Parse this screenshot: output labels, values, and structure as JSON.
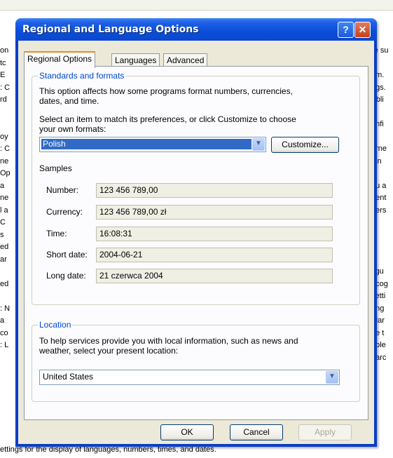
{
  "background": {
    "left_snippets": [
      "on",
      "tc",
      "E",
      ": C",
      "rd",
      "",
      "",
      "oy",
      ": C",
      "ne",
      "Op",
      "a",
      "ne",
      "l a",
      "C",
      "s",
      "ed",
      "ar",
      "",
      "ed",
      "",
      ": N",
      "a",
      "co",
      ": L"
    ],
    "right_snippets": [
      "re su",
      "",
      "em.",
      "ngs.",
      "r bli",
      "",
      "onfi",
      "",
      "erne",
      "ttin",
      "",
      "ou a",
      "nent",
      "bers",
      "",
      "",
      "",
      "",
      "figu",
      "ecog",
      "setti",
      "ang",
      "Mar",
      "he t",
      "ople",
      "narc"
    ],
    "status_line": "ettings for the display of languages, numbers, times, and dates."
  },
  "dialog": {
    "title": "Regional and Language Options",
    "help_label": "?",
    "close_label": "✕",
    "tabs": [
      {
        "label": "Regional Options"
      },
      {
        "label": "Languages"
      },
      {
        "label": "Advanced"
      }
    ],
    "standards": {
      "legend": "Standards and formats",
      "desc1": "This option affects how some programs format numbers, currencies,",
      "desc2": "dates, and time.",
      "instr1": "Select an item to match its preferences, or click Customize to choose",
      "instr2": "your own formats:",
      "selected_format": "Polish",
      "customize_label": "Customize...",
      "samples_heading": "Samples",
      "samples": [
        {
          "label": "Number:",
          "value": "123 456 789,00"
        },
        {
          "label": "Currency:",
          "value": "123 456 789,00 zł"
        },
        {
          "label": "Time:",
          "value": "16:08:31"
        },
        {
          "label": "Short date:",
          "value": "2004-06-21"
        },
        {
          "label": "Long date:",
          "value": "21 czerwca 2004"
        }
      ]
    },
    "location": {
      "legend": "Location",
      "desc1": "To help services provide you with local information, such as news and",
      "desc2": "weather, select your present location:",
      "selected_location": "United States"
    },
    "buttons": {
      "ok": "OK",
      "cancel": "Cancel",
      "apply": "Apply"
    }
  }
}
